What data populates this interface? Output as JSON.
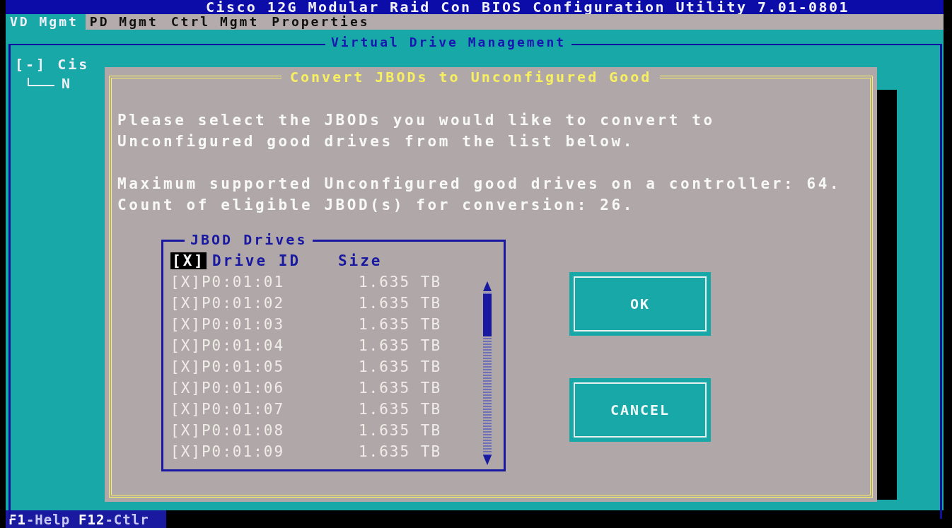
{
  "window": {
    "title": "Cisco 12G Modular Raid Con BIOS Configuration Utility 7.01-0801"
  },
  "menu": [
    {
      "label": "VD Mgmt",
      "selected": true
    },
    {
      "label": "PD Mgmt",
      "selected": false
    },
    {
      "label": "Ctrl Mgmt",
      "selected": false
    },
    {
      "label": "Properties",
      "selected": false
    }
  ],
  "panel": {
    "title": "Virtual Drive Management",
    "tree": [
      {
        "label": "[-] Cis",
        "children": [
          {
            "label": "N"
          }
        ]
      }
    ]
  },
  "dialog": {
    "title": "Convert JBODs to Unconfigured Good",
    "paragraphs": [
      [
        "Please select the JBODs you would like to convert to",
        "Unconfigured good drives from the list below."
      ],
      [
        "Maximum supported Unconfigured good drives on a controller: 64.",
        "Count of eligible JBOD(s) for conversion: 26."
      ]
    ],
    "list": {
      "title": "JBOD Drives",
      "header": {
        "check": "[X]",
        "focused": true,
        "columns": [
          "Drive ID",
          "Size"
        ]
      },
      "rows": [
        {
          "check": "[X]",
          "checked": true,
          "id": "P0:01:01",
          "size": "1.635 TB"
        },
        {
          "check": "[X]",
          "checked": true,
          "id": "P0:01:02",
          "size": "1.635 TB"
        },
        {
          "check": "[X]",
          "checked": true,
          "id": "P0:01:03",
          "size": "1.635 TB"
        },
        {
          "check": "[X]",
          "checked": true,
          "id": "P0:01:04",
          "size": "1.635 TB"
        },
        {
          "check": "[X]",
          "checked": true,
          "id": "P0:01:05",
          "size": "1.635 TB"
        },
        {
          "check": "[X]",
          "checked": true,
          "id": "P0:01:06",
          "size": "1.635 TB"
        },
        {
          "check": "[X]",
          "checked": true,
          "id": "P0:01:07",
          "size": "1.635 TB"
        },
        {
          "check": "[X]",
          "checked": true,
          "id": "P0:01:08",
          "size": "1.635 TB"
        },
        {
          "check": "[X]",
          "checked": true,
          "id": "P0:01:09",
          "size": "1.635 TB"
        }
      ]
    },
    "buttons": [
      {
        "label": "OK"
      },
      {
        "label": "CANCEL"
      }
    ]
  },
  "status_bar": [
    {
      "key": "F1",
      "text": "-Help"
    },
    {
      "key": "F12",
      "text": "-Ctlr"
    }
  ]
}
